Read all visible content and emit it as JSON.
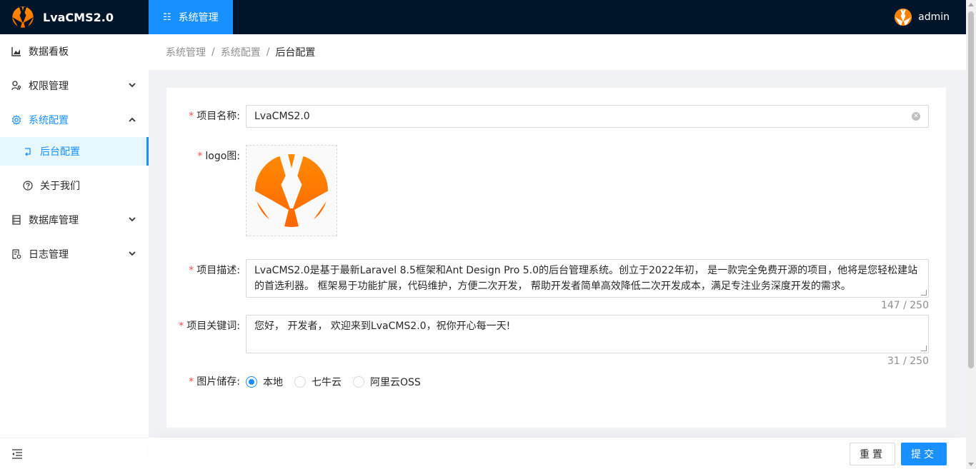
{
  "app": {
    "title": "LvaCMS2.0"
  },
  "header": {
    "active_menu": "系统管理",
    "username": "admin"
  },
  "sidebar": {
    "items": [
      {
        "label": "数据看板",
        "icon": "chart-icon"
      },
      {
        "label": "权限管理",
        "icon": "user-key-icon"
      },
      {
        "label": "系统配置",
        "icon": "gear-icon"
      },
      {
        "label": "后台配置",
        "icon": "enter-icon"
      },
      {
        "label": "关于我们",
        "icon": "question-icon"
      },
      {
        "label": "数据库管理",
        "icon": "database-icon"
      },
      {
        "label": "日志管理",
        "icon": "log-icon"
      }
    ]
  },
  "breadcrumb": [
    "系统管理",
    "系统配置",
    "后台配置"
  ],
  "form": {
    "name_label": "项目名称:",
    "name_value": "LvaCMS2.0",
    "logo_label": "logo图:",
    "desc_label": "项目描述:",
    "desc_value": "LvaCMS2.0是基于最新Laravel 8.5框架和Ant Design Pro 5.0的后台管理系统。创立于2022年初， 是一款完全免费开源的项目，他将是您轻松建站的首选利器。 框架易于功能扩展，代码维护，方便二次开发， 帮助开发者简单高效降低二次开发成本，满足专注业务深度开发的需求。",
    "desc_count": "147 / 250",
    "keywords_label": "项目关键词:",
    "keywords_value": "您好， 开发者， 欢迎来到LvaCMS2.0，祝你开心每一天!",
    "keywords_count": "31 / 250",
    "storage_label": "图片储存:",
    "storage_options": [
      "本地",
      "七牛云",
      "阿里云OSS"
    ],
    "storage_selected": "本地"
  },
  "footer": {
    "reset_label": "重置",
    "submit_label": "提交"
  },
  "colors": {
    "primary": "#1890ff",
    "header_bg": "#001529",
    "logo_orange": "#ff7a00"
  }
}
